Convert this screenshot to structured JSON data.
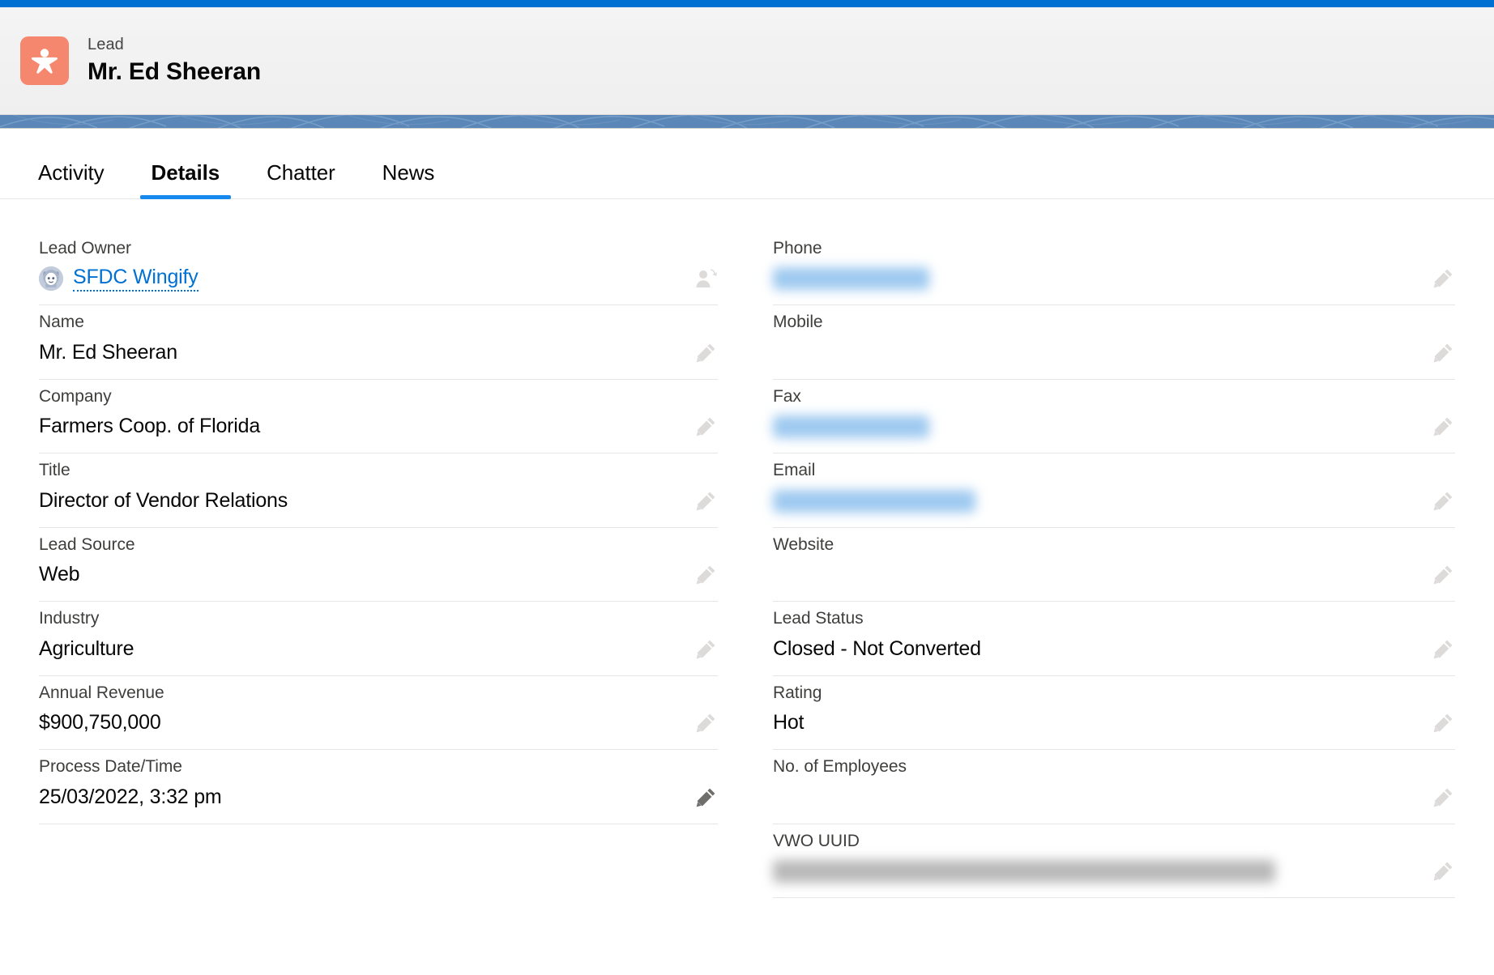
{
  "theme": {
    "accent_blue": "#0070d2",
    "tab_underline": "#1589ee",
    "lead_icon_bg": "#f5876e",
    "banner_blue": "#5a87b8",
    "link_blue": "#0070d2"
  },
  "header": {
    "object_label": "Lead",
    "record_name": "Mr. Ed Sheeran",
    "icon": "lead-person-icon"
  },
  "tabs": [
    {
      "label": "Activity",
      "active": false
    },
    {
      "label": "Details",
      "active": true
    },
    {
      "label": "Chatter",
      "active": false
    },
    {
      "label": "News",
      "active": false
    }
  ],
  "details": {
    "left_column": [
      {
        "label": "Lead Owner",
        "value": "SFDC Wingify",
        "kind": "owner-link",
        "avatar": "astro-avatar",
        "action_icon": "change-owner-icon",
        "action_state": "light"
      },
      {
        "label": "Name",
        "value": "Mr. Ed Sheeran",
        "kind": "text",
        "action_icon": "pencil-icon",
        "action_state": "light"
      },
      {
        "label": "Company",
        "value": "Farmers Coop. of Florida",
        "kind": "text",
        "action_icon": "pencil-icon",
        "action_state": "light"
      },
      {
        "label": "Title",
        "value": "Director of Vendor Relations",
        "kind": "text",
        "action_icon": "pencil-icon",
        "action_state": "light"
      },
      {
        "label": "Lead Source",
        "value": "Web",
        "kind": "text",
        "action_icon": "pencil-icon",
        "action_state": "light"
      },
      {
        "label": "Industry",
        "value": "Agriculture",
        "kind": "text",
        "action_icon": "pencil-icon",
        "action_state": "light"
      },
      {
        "label": "Annual Revenue",
        "value": "$900,750,000",
        "kind": "text",
        "action_icon": "pencil-icon",
        "action_state": "light"
      },
      {
        "label": "Process Date/Time",
        "value": "25/03/2022, 3:32 pm",
        "kind": "text",
        "action_icon": "pencil-icon",
        "action_state": "dark"
      }
    ],
    "right_column": [
      {
        "label": "Phone",
        "value": "",
        "kind": "redacted-link",
        "redacted_width": 193,
        "action_icon": "pencil-icon",
        "action_state": "light"
      },
      {
        "label": "Mobile",
        "value": "",
        "kind": "empty",
        "action_icon": "pencil-icon",
        "action_state": "light"
      },
      {
        "label": "Fax",
        "value": "",
        "kind": "redacted-link",
        "redacted_width": 193,
        "action_icon": "pencil-icon",
        "action_state": "light"
      },
      {
        "label": "Email",
        "value": "",
        "kind": "redacted-link",
        "redacted_width": 250,
        "action_icon": "pencil-icon",
        "action_state": "light"
      },
      {
        "label": "Website",
        "value": "",
        "kind": "empty",
        "action_icon": "pencil-icon",
        "action_state": "light"
      },
      {
        "label": "Lead Status",
        "value": "Closed - Not Converted",
        "kind": "text",
        "action_icon": "pencil-icon",
        "action_state": "light"
      },
      {
        "label": "Rating",
        "value": "Hot",
        "kind": "text",
        "action_icon": "pencil-icon",
        "action_state": "light"
      },
      {
        "label": "No. of Employees",
        "value": "",
        "kind": "empty",
        "action_icon": "pencil-icon",
        "action_state": "light"
      },
      {
        "label": "VWO UUID",
        "value": "",
        "kind": "redacted-text",
        "redacted_width": 620,
        "action_icon": "pencil-icon",
        "action_state": "light"
      }
    ]
  }
}
